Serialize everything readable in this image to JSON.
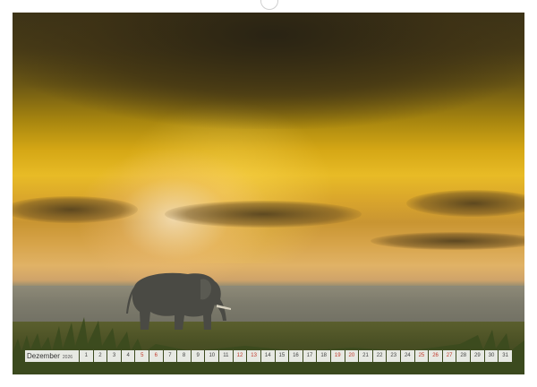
{
  "calendar": {
    "month": "Dezember",
    "year": "2026",
    "days": [
      {
        "d": "1",
        "red": false
      },
      {
        "d": "2",
        "red": false
      },
      {
        "d": "3",
        "red": false
      },
      {
        "d": "4",
        "red": false
      },
      {
        "d": "5",
        "red": true
      },
      {
        "d": "6",
        "red": true
      },
      {
        "d": "7",
        "red": false
      },
      {
        "d": "8",
        "red": false
      },
      {
        "d": "9",
        "red": false
      },
      {
        "d": "10",
        "red": false
      },
      {
        "d": "11",
        "red": false
      },
      {
        "d": "12",
        "red": true
      },
      {
        "d": "13",
        "red": true
      },
      {
        "d": "14",
        "red": false
      },
      {
        "d": "15",
        "red": false
      },
      {
        "d": "16",
        "red": false
      },
      {
        "d": "17",
        "red": false
      },
      {
        "d": "18",
        "red": false
      },
      {
        "d": "19",
        "red": true
      },
      {
        "d": "20",
        "red": true
      },
      {
        "d": "21",
        "red": false
      },
      {
        "d": "22",
        "red": false
      },
      {
        "d": "23",
        "red": false
      },
      {
        "d": "24",
        "red": false
      },
      {
        "d": "25",
        "red": true
      },
      {
        "d": "26",
        "red": true
      },
      {
        "d": "27",
        "red": true
      },
      {
        "d": "28",
        "red": false
      },
      {
        "d": "29",
        "red": false
      },
      {
        "d": "30",
        "red": false
      },
      {
        "d": "31",
        "red": false
      }
    ]
  },
  "colors": {
    "holiday": "#c0392b",
    "sky_gold": "#e8bb26",
    "storm_cloud": "#3d3418"
  },
  "icons": {
    "binding": "spiral-binding-icon",
    "hanger": "hanger-hole-icon"
  }
}
